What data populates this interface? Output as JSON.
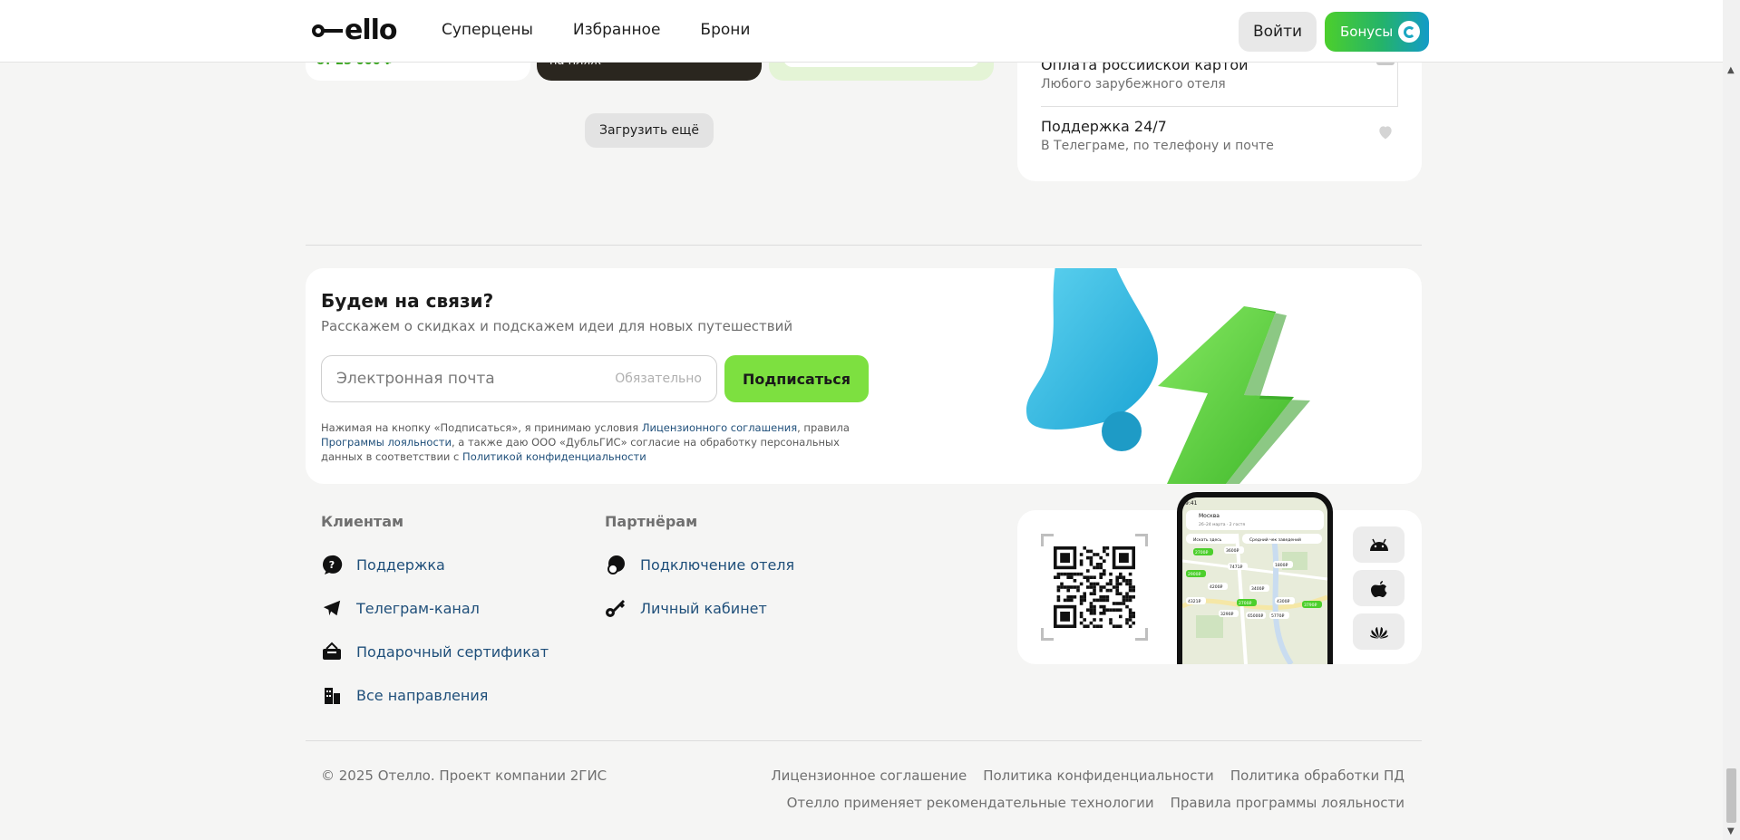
{
  "header": {
    "logo_text": "ello",
    "nav": [
      "Суперцены",
      "Избранное",
      "Брони"
    ],
    "login_label": "Войти",
    "bonus_label": "Бонусы"
  },
  "cards_partial": {
    "price_text": "от 25 000 ₽",
    "photo_caption": "на пляж"
  },
  "load_more_label": "Загрузить ещё",
  "features": [
    {
      "title": "Оплата российской картой",
      "subtitle": "Любого зарубежного отеля"
    },
    {
      "title": "Поддержка 24/7",
      "subtitle": "В Телеграме, по телефону и почте"
    }
  ],
  "subscribe": {
    "title": "Будем на связи?",
    "description": "Расскажем о скидках и подскажем идеи для новых путешествий",
    "email_placeholder": "Электронная почта",
    "required_label": "Обязательно",
    "button_label": "Подписаться",
    "legal": {
      "p1": "Нажимая на кнопку «Подписаться», я принимаю условия ",
      "link1": "Лицензионного соглашения",
      "p2": ", правила ",
      "link2": "Программы лояльности",
      "p3": ", а также даю ООО «ДубльГИС» согласие на обработку персональных данных в соответствии с ",
      "link3": "Политикой конфиденциальности"
    }
  },
  "footer": {
    "clients": {
      "title": "Клиентам",
      "links": [
        "Поддержка",
        "Телеграм-канал",
        "Подарочный сертификат",
        "Все направления"
      ]
    },
    "partners": {
      "title": "Партнёрам",
      "links": [
        "Подключение отеля",
        "Личный кабинет"
      ]
    },
    "copyright": "© 2025 Отелло. Проект компании 2ГИС",
    "legal_row1": [
      "Лицензионное соглашение",
      "Политика конфиденциальности",
      "Политика обработки ПД"
    ],
    "legal_row2": [
      "Отелло применяет рекомендательные технологии",
      "Правила программы лояльности"
    ]
  },
  "app": {
    "phone_city": "Москва",
    "phone_dates": "26–24 марта · 2 гостя",
    "phone_chip1": "Искать здесь",
    "phone_chip2": "Средний чек заведений",
    "map_prices": [
      "2700₽",
      "3600₽",
      "7471₽",
      "1800₽",
      "2900₽",
      "4200₽",
      "3400₽",
      "4321₽",
      "2700₽",
      "3290₽",
      "65000₽",
      "4300₽",
      "3790₽",
      "5770₽"
    ],
    "stores": [
      "android-icon",
      "apple-icon",
      "huawei-icon"
    ]
  },
  "colors": {
    "accent_green": "#7de040",
    "link_blue": "#1f4f7a",
    "bonus_gradient_end": "#139bc8"
  }
}
